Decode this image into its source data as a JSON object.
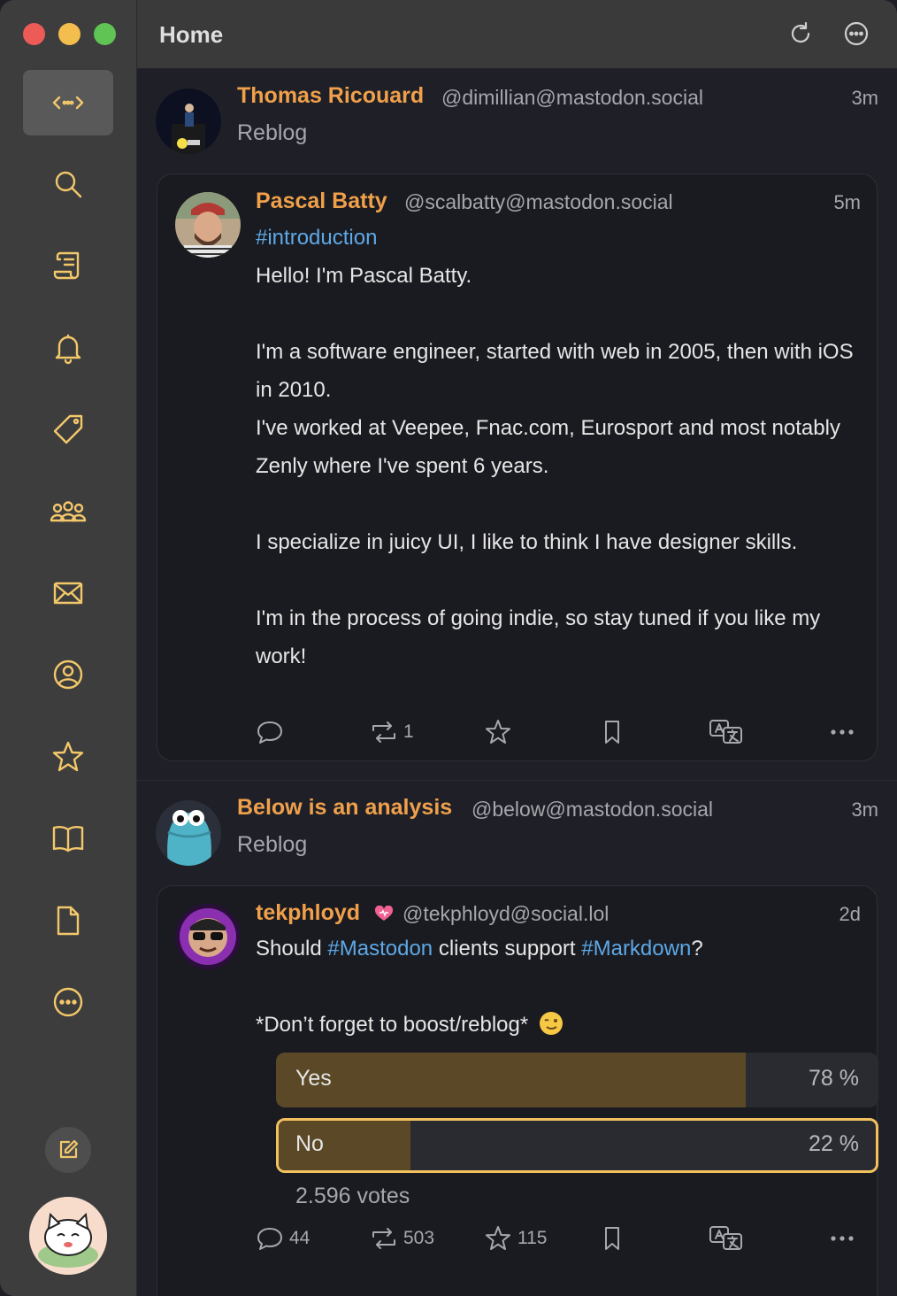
{
  "header": {
    "title": "Home"
  },
  "sidebar": {
    "items": [
      {
        "name": "timeline-icon"
      },
      {
        "name": "search-icon"
      },
      {
        "name": "scroll-icon"
      },
      {
        "name": "bell-icon"
      },
      {
        "name": "tag-icon"
      },
      {
        "name": "people-icon"
      },
      {
        "name": "envelope-icon"
      },
      {
        "name": "profile-icon"
      },
      {
        "name": "star-icon"
      },
      {
        "name": "book-icon"
      },
      {
        "name": "document-icon"
      },
      {
        "name": "more-icon"
      }
    ],
    "accent": "#f3c86a"
  },
  "posts": [
    {
      "reblogger": {
        "name": "Thomas Ricouard",
        "handle": "@dimillian@mastodon.social",
        "time": "3m",
        "label": "Reblog"
      },
      "author": {
        "name": "Pascal Batty",
        "handle": "@scalbatty@mastodon.social",
        "time": "5m"
      },
      "hashtag": "#introduction",
      "text": "Hello! I'm Pascal Batty.\n\nI'm a software engineer, started with web in 2005, then with iOS in 2010.\nI've worked at Veepee, Fnac.com, Eurosport and most notably Zenly where I've spent 6 years.\n\nI specialize in juicy UI, I like to think I have designer skills.\n\nI'm in the process of going indie, so stay tuned if you like my work!",
      "stats": {
        "replies": "",
        "boosts": "1",
        "favorites": ""
      }
    },
    {
      "reblogger": {
        "name": "Below is an analysis",
        "handle": "@below@mastodon.social",
        "time": "3m",
        "label": "Reblog"
      },
      "author": {
        "name": "tekphloyd",
        "handle": "@tekphloyd@social.lol",
        "time": "2d"
      },
      "text_parts": {
        "a": "Should ",
        "tag1": "#Mastodon",
        "b": " clients support ",
        "tag2": "#Markdown",
        "c": "?"
      },
      "text2": "*Don’t forget to boost/reblog*",
      "poll": {
        "options": [
          {
            "label": "Yes",
            "percent_text": "78 %",
            "fraction": 0.78
          },
          {
            "label": "No",
            "percent_text": "22 %",
            "fraction": 0.22
          }
        ],
        "votes": "2.596 votes"
      },
      "stats": {
        "replies": "44",
        "boosts": "503",
        "favorites": "115"
      }
    }
  ]
}
